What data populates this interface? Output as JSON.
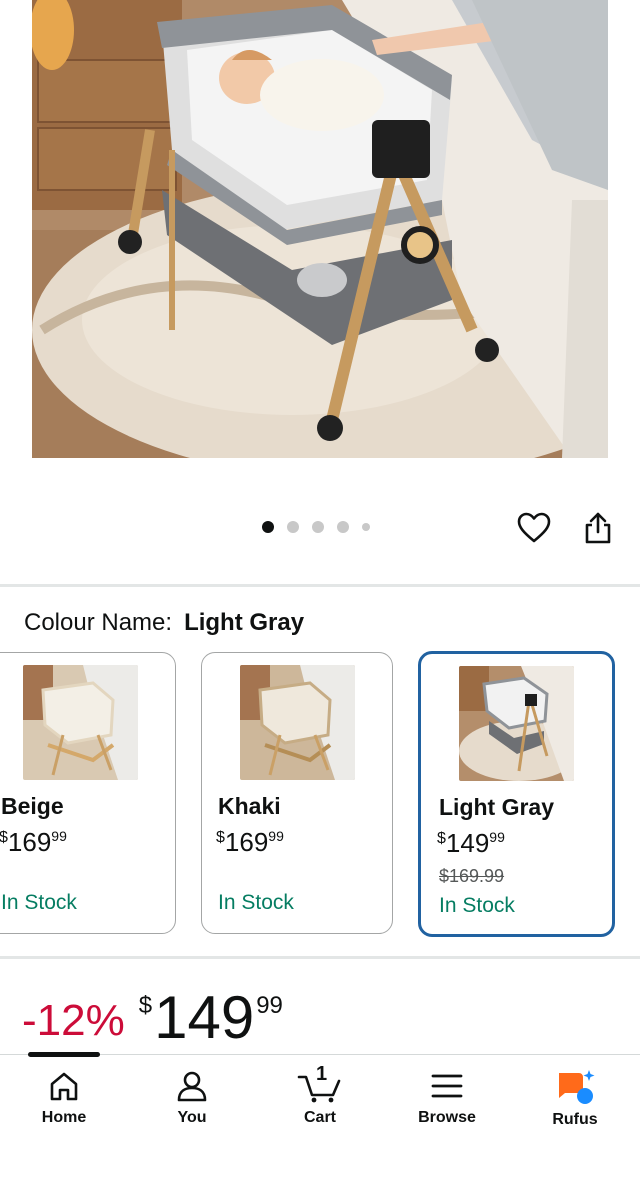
{
  "product": {
    "image_alt": "Bedside bassinet with wooden legs in light gray",
    "carousel": {
      "total": 5,
      "active": 0
    }
  },
  "icons": {
    "wishlist": "heart-icon",
    "share": "share-icon"
  },
  "colour": {
    "label": "Colour Name:",
    "selected": "Light Gray",
    "options": [
      {
        "name": "Beige",
        "currency": "$",
        "whole": "169",
        "fraction": "99",
        "was": "",
        "stock": "In Stock"
      },
      {
        "name": "Khaki",
        "currency": "$",
        "whole": "169",
        "fraction": "99",
        "was": "",
        "stock": "In Stock"
      },
      {
        "name": "Light Gray",
        "currency": "$",
        "whole": "149",
        "fraction": "99",
        "was": "$169.99",
        "stock": "In Stock"
      }
    ]
  },
  "price": {
    "discount": "-12%",
    "currency": "$",
    "whole": "149",
    "fraction": "99"
  },
  "nav": {
    "items": [
      {
        "label": "Home",
        "icon": "home-icon"
      },
      {
        "label": "You",
        "icon": "user-icon"
      },
      {
        "label": "Cart",
        "icon": "cart-icon",
        "badge": "1"
      },
      {
        "label": "Browse",
        "icon": "menu-icon"
      },
      {
        "label": "Rufus",
        "icon": "rufus-icon"
      }
    ]
  },
  "colors": {
    "accent_selected": "#2162a1",
    "in_stock": "#067d62",
    "discount": "#cc0c39",
    "rufus_orange": "#ff6a1a",
    "rufus_blue": "#1a8cff"
  }
}
